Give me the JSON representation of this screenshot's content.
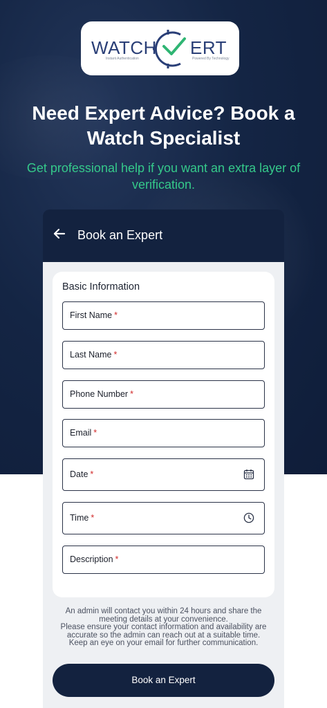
{
  "brand": {
    "left_text": "WATCH",
    "right_text": "ERT",
    "tagline_left": "Instant Authentication",
    "tagline_right": "Powered By Technology"
  },
  "hero": {
    "headline": "Need Expert Advice? Book a Watch Specialist",
    "subheadline": "Get professional help if you want an extra layer of verification."
  },
  "header": {
    "back_icon": "arrow-left-icon",
    "title": "Book an Expert"
  },
  "form": {
    "section_title": "Basic Information",
    "required_mark": "*",
    "fields": [
      {
        "label": "First Name"
      },
      {
        "label": "Last Name"
      },
      {
        "label": "Phone Number"
      },
      {
        "label": "Email"
      },
      {
        "label": "Date",
        "icon": "calendar-icon"
      },
      {
        "label": "Time",
        "icon": "clock-icon"
      },
      {
        "label": "Description"
      }
    ]
  },
  "note": {
    "line1": "An admin will contact you within 24 hours and share the meeting details at your convenience.",
    "line2": "Please ensure your contact information and availability are accurate so the admin can reach out at a suitable time.",
    "line3": "Keep an eye on your email for further communication."
  },
  "actions": {
    "submit_label": "Book an Expert"
  },
  "colors": {
    "navy": "#13223f",
    "accent_green": "#35c98a",
    "required_red": "#d12a2a"
  }
}
